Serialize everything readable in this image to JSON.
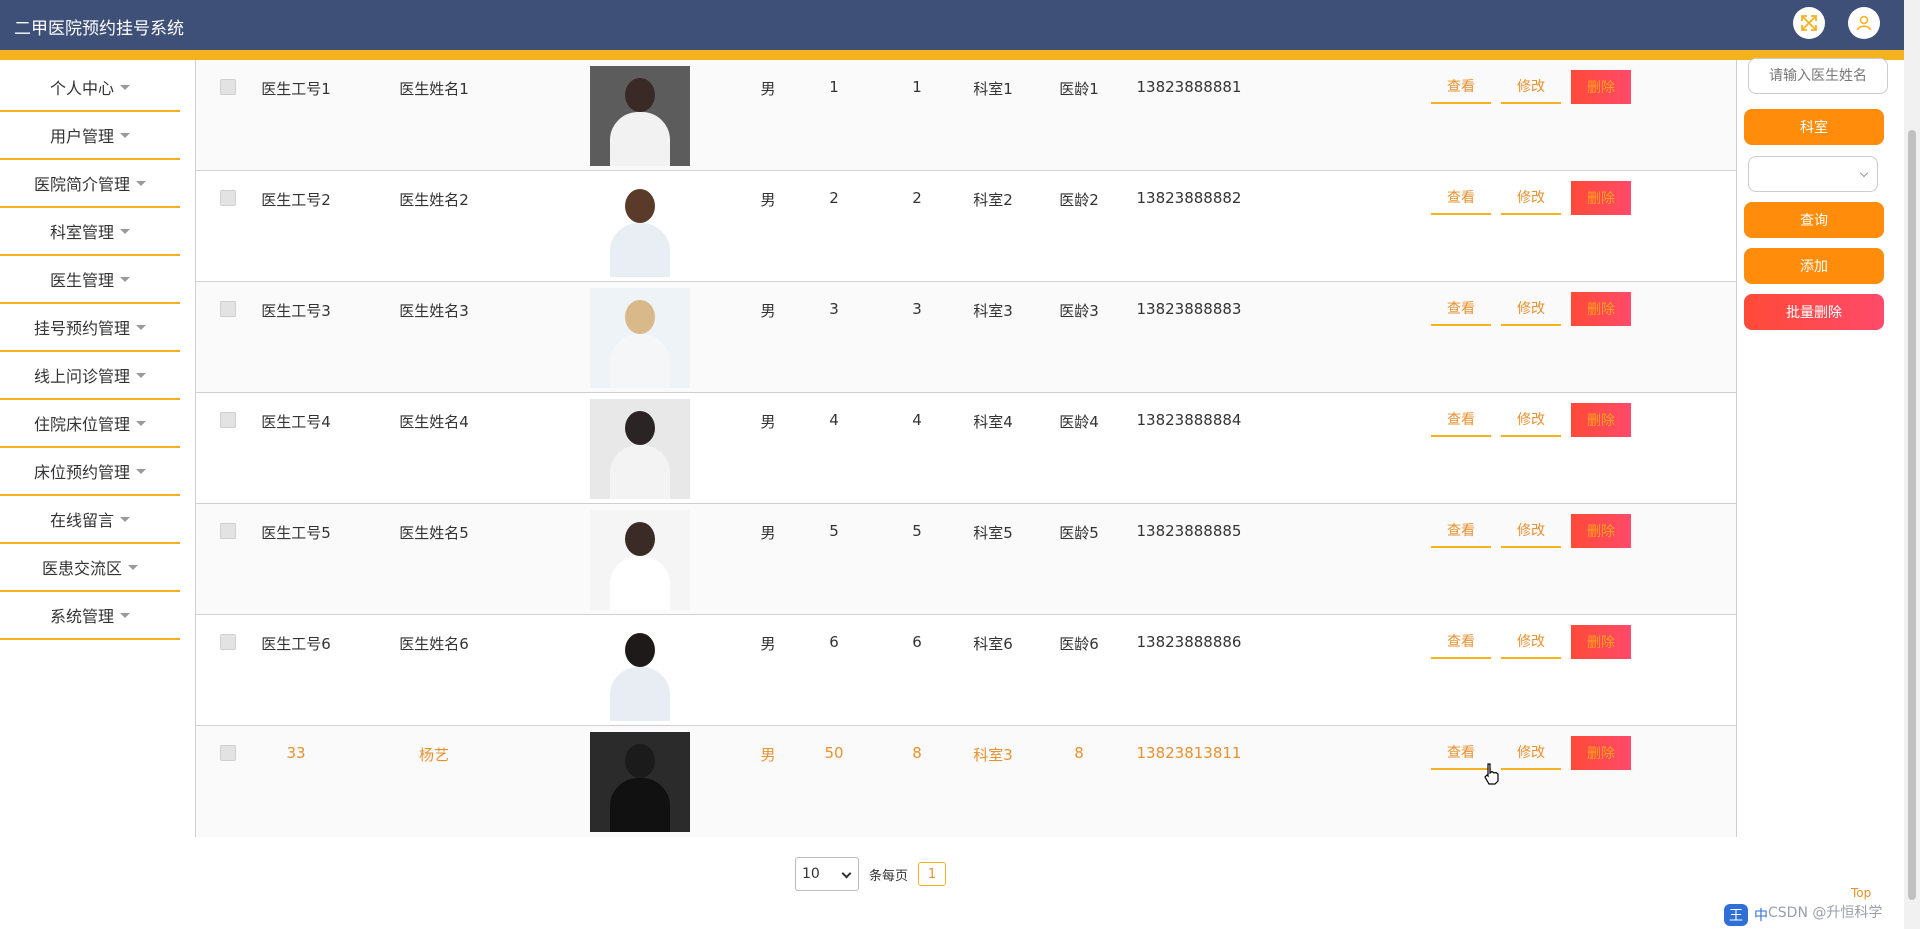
{
  "header": {
    "title": "二甲医院预约挂号系统",
    "icons": [
      "fullscreen-icon",
      "user-icon"
    ]
  },
  "sidebar": {
    "items": [
      {
        "label": "个人中心"
      },
      {
        "label": "用户管理"
      },
      {
        "label": "医院简介管理"
      },
      {
        "label": "科室管理"
      },
      {
        "label": "医生管理"
      },
      {
        "label": "挂号预约管理"
      },
      {
        "label": "线上问诊管理"
      },
      {
        "label": "住院床位管理"
      },
      {
        "label": "床位预约管理"
      },
      {
        "label": "在线留言"
      },
      {
        "label": "医患交流区"
      },
      {
        "label": "系统管理"
      }
    ]
  },
  "table": {
    "rows": [
      {
        "id": "医生工号1",
        "name": "医生姓名1",
        "gender": "男",
        "c1": "1",
        "c2": "1",
        "dept": "科室1",
        "age": "医龄1",
        "phone": "13823888881",
        "photo_colors": [
          "#5c5c5c",
          "#3a2a26",
          "#f2f2f2"
        ]
      },
      {
        "id": "医生工号2",
        "name": "医生姓名2",
        "gender": "男",
        "c1": "2",
        "c2": "2",
        "dept": "科室2",
        "age": "医龄2",
        "phone": "13823888882",
        "photo_colors": [
          "#ffffff",
          "#5a3b2a",
          "#e9eef4"
        ]
      },
      {
        "id": "医生工号3",
        "name": "医生姓名3",
        "gender": "男",
        "c1": "3",
        "c2": "3",
        "dept": "科室3",
        "age": "医龄3",
        "phone": "13823888883",
        "photo_colors": [
          "#eef3f7",
          "#d9b88a",
          "#f4f6f8"
        ]
      },
      {
        "id": "医生工号4",
        "name": "医生姓名4",
        "gender": "男",
        "c1": "4",
        "c2": "4",
        "dept": "科室4",
        "age": "医龄4",
        "phone": "13823888884",
        "photo_colors": [
          "#e8e8e8",
          "#2b2424",
          "#f3f3f3"
        ]
      },
      {
        "id": "医生工号5",
        "name": "医生姓名5",
        "gender": "男",
        "c1": "5",
        "c2": "5",
        "dept": "科室5",
        "age": "医龄5",
        "phone": "13823888885",
        "photo_colors": [
          "#f5f5f5",
          "#3b2b26",
          "#ffffff"
        ]
      },
      {
        "id": "医生工号6",
        "name": "医生姓名6",
        "gender": "男",
        "c1": "6",
        "c2": "6",
        "dept": "科室6",
        "age": "医龄6",
        "phone": "13823888886",
        "photo_colors": [
          "#ffffff",
          "#1f1a1a",
          "#e7edf3"
        ]
      },
      {
        "id": "33",
        "name": "杨艺",
        "gender": "男",
        "c1": "50",
        "c2": "8",
        "dept": "科室3",
        "age": "8",
        "phone": "13823813811",
        "photo_colors": [
          "#2b2b2b",
          "#1b1b1b",
          "#111111"
        ]
      }
    ],
    "view_label": "查看",
    "edit_label": "修改",
    "delete_label": "删除"
  },
  "pagination": {
    "page_size": "10",
    "per_page_label": "条每页",
    "current_page": "1"
  },
  "right_panel": {
    "search_placeholder": "请输入医生姓名",
    "dept_button": "科室",
    "query_button": "查询",
    "add_button": "添加",
    "batch_delete_button": "批量删除"
  },
  "footer": {
    "top_label": "Top",
    "watermark": "CSDN @升恒科学",
    "ime_label": "王",
    "ime_lang": "中"
  },
  "colors": {
    "header_bg": "#3f5078",
    "accent": "#f5b21f",
    "link": "#e8912f",
    "danger": "#ff4a4a",
    "primary_btn": "#ff8c0a"
  }
}
